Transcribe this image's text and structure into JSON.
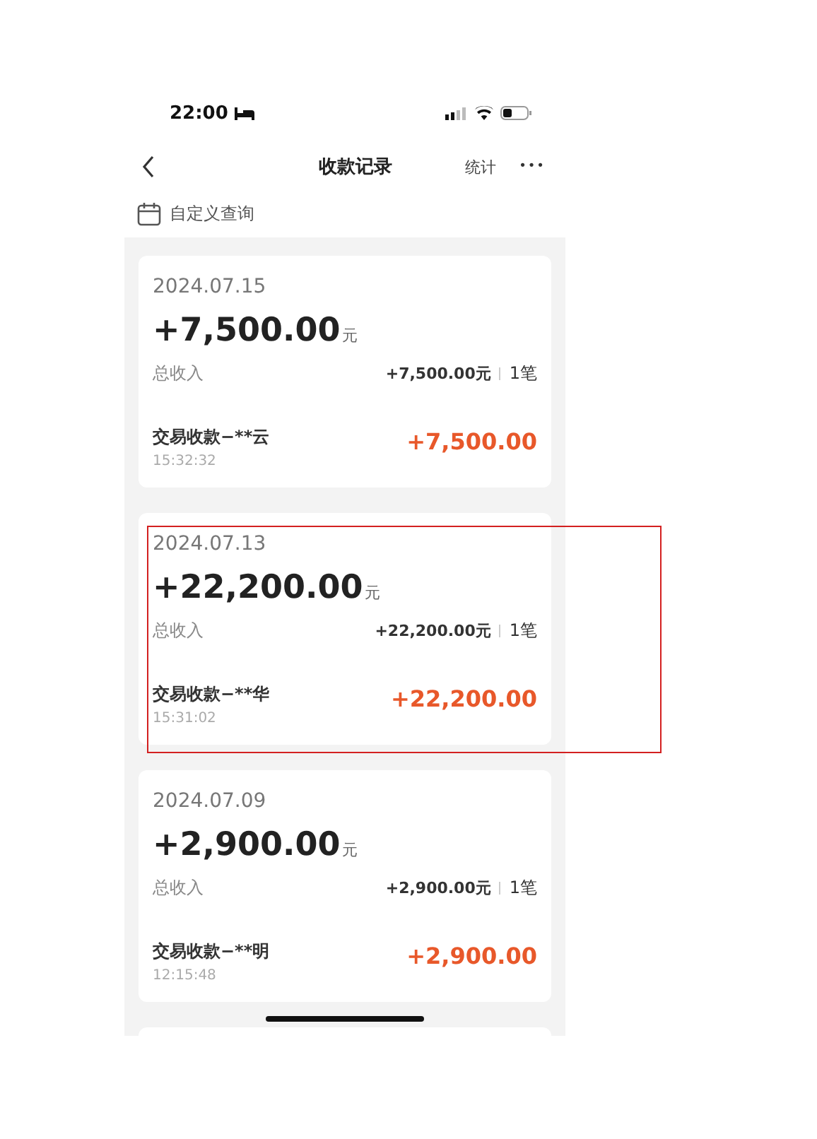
{
  "status_bar": {
    "time": "22:00"
  },
  "nav": {
    "title": "收款记录",
    "action": "统计",
    "more": "•••"
  },
  "query": {
    "label": "自定义查询"
  },
  "records": [
    {
      "date": "2024.07.15",
      "total": "+7,500.00",
      "unit": "元",
      "income_label": "总收入",
      "income_sum": "+7,500.00元",
      "count": "1笔",
      "item_name": "交易收款−**云",
      "item_time": "15:32:32",
      "item_amount": "+7,500.00",
      "highlighted": false
    },
    {
      "date": "2024.07.13",
      "total": "+22,200.00",
      "unit": "元",
      "income_label": "总收入",
      "income_sum": "+22,200.00元",
      "count": "1笔",
      "item_name": "交易收款−**华",
      "item_time": "15:31:02",
      "item_amount": "+22,200.00",
      "highlighted": true
    },
    {
      "date": "2024.07.09",
      "total": "+2,900.00",
      "unit": "元",
      "income_label": "总收入",
      "income_sum": "+2,900.00元",
      "count": "1笔",
      "item_name": "交易收款−**明",
      "item_time": "12:15:48",
      "item_amount": "+2,900.00",
      "highlighted": false
    }
  ]
}
